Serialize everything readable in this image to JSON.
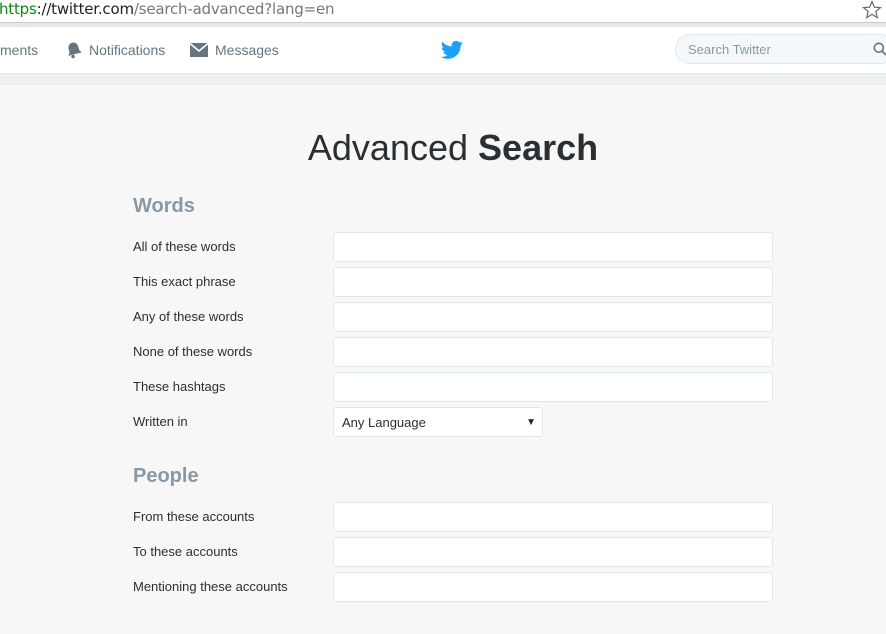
{
  "browser": {
    "url_scheme": "https",
    "url_host": "://twitter.com",
    "url_path": "/search-advanced?lang=en"
  },
  "nav": {
    "items": [
      {
        "label": "ments",
        "icon": "bolt-icon"
      },
      {
        "label": "Notifications",
        "icon": "bell-icon"
      },
      {
        "label": "Messages",
        "icon": "envelope-icon"
      }
    ],
    "logo": "twitter-bird-icon",
    "search_placeholder": "Search Twitter"
  },
  "page": {
    "title_normal": "Advanced",
    "title_bold": "Search"
  },
  "sections": {
    "words": {
      "title": "Words",
      "fields": [
        {
          "label": "All of these words",
          "value": ""
        },
        {
          "label": "This exact phrase",
          "value": ""
        },
        {
          "label": "Any of these words",
          "value": ""
        },
        {
          "label": "None of these words",
          "value": ""
        },
        {
          "label": "These hashtags",
          "value": ""
        }
      ],
      "language_label": "Written in",
      "language_value": "Any Language"
    },
    "people": {
      "title": "People",
      "fields": [
        {
          "label": "From these accounts",
          "value": ""
        },
        {
          "label": "To these accounts",
          "value": ""
        },
        {
          "label": "Mentioning these accounts",
          "value": ""
        }
      ]
    }
  },
  "colors": {
    "accent": "#1da1f2",
    "section_title": "#8899a6",
    "url_scheme": "#0a8a10"
  }
}
